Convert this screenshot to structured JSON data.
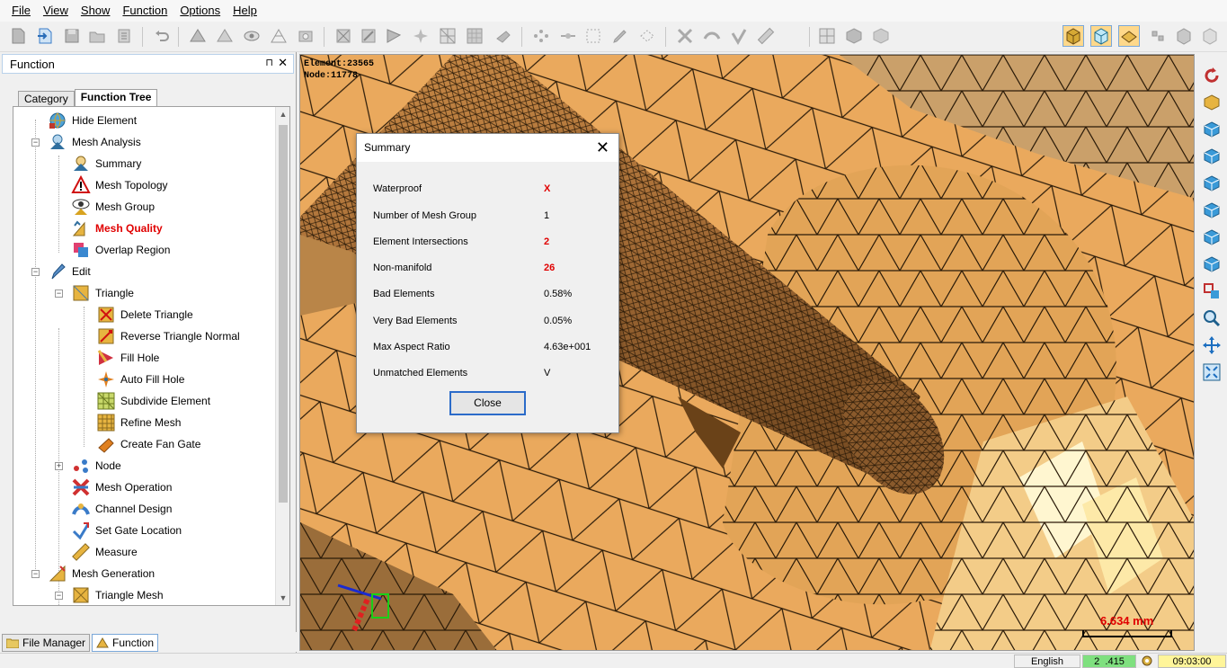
{
  "menu": [
    "File",
    "View",
    "Show",
    "Function",
    "Options",
    "Help"
  ],
  "panel": {
    "title": "Function",
    "pin": "⊓",
    "close": "✕",
    "tabs": [
      "Category",
      "Function Tree"
    ],
    "tree": [
      {
        "label": "Hide Element"
      },
      {
        "label": "Mesh Analysis"
      },
      {
        "label": "Summary"
      },
      {
        "label": "Mesh Topology"
      },
      {
        "label": "Mesh Group"
      },
      {
        "label": "Mesh Quality"
      },
      {
        "label": "Overlap Region"
      },
      {
        "label": "Edit"
      },
      {
        "label": "Triangle"
      },
      {
        "label": "Delete Triangle"
      },
      {
        "label": "Reverse Triangle Normal"
      },
      {
        "label": "Fill Hole"
      },
      {
        "label": "Auto Fill Hole"
      },
      {
        "label": "Subdivide Element"
      },
      {
        "label": "Refine Mesh"
      },
      {
        "label": "Create Fan Gate"
      },
      {
        "label": "Node"
      },
      {
        "label": "Mesh Operation"
      },
      {
        "label": "Channel Design"
      },
      {
        "label": "Set Gate Location"
      },
      {
        "label": "Measure"
      },
      {
        "label": "Mesh Generation"
      },
      {
        "label": "Triangle Mesh"
      }
    ],
    "bottom_tabs": [
      "File Manager",
      "Function"
    ]
  },
  "viewport": {
    "info_line1": "Element:23565",
    "info_line2": "Node:11778",
    "scale": "6.634 mm"
  },
  "dialog": {
    "title": "Summary",
    "close_glyph": "✕",
    "rows": [
      {
        "label": "Waterproof",
        "value": "X"
      },
      {
        "label": "Number of Mesh Group",
        "value": "1"
      },
      {
        "label": "Element Intersections",
        "value": "2"
      },
      {
        "label": "Non-manifold",
        "value": "26"
      },
      {
        "label": "Bad Elements",
        "value": "0.58%"
      },
      {
        "label": "Very Bad Elements",
        "value": "0.05%"
      },
      {
        "label": "Max Aspect Ratio",
        "value": "4.63e+001"
      },
      {
        "label": "Unmatched Elements",
        "value": "V"
      }
    ],
    "close_button": "Close"
  },
  "status": {
    "language": "English",
    "counter_a": "2",
    "counter_b": ".415",
    "time": "09:03:00"
  },
  "colors": {
    "accent_red": "#e00000",
    "mesh_fill": "#e9a95e",
    "status_green": "#7fe07f",
    "status_yellow": "#fff59a"
  }
}
